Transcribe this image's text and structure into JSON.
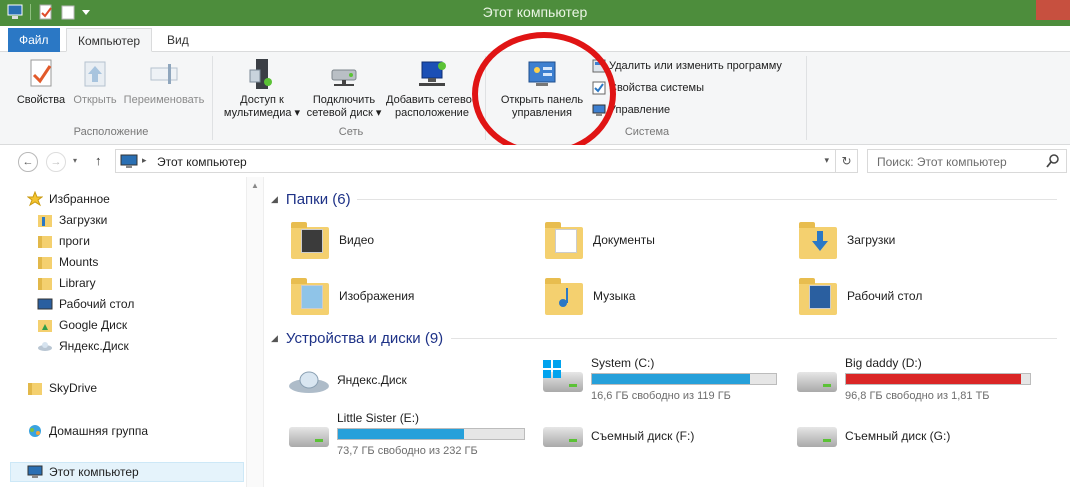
{
  "window": {
    "title": "Этот компьютер"
  },
  "colors": {
    "titlebar": "#4d8d3c",
    "file_tab": "#2b78c5",
    "progress": "#26a0da",
    "progress_full": "#da2626",
    "section_header": "#1e3287",
    "annotation_circle": "#e01414"
  },
  "ribbon": {
    "tabs": [
      "Файл",
      "Компьютер",
      "Вид"
    ],
    "groups": {
      "location": {
        "label": "Расположение",
        "properties": "Свойства",
        "open": "Открыть",
        "rename": "Переименовать"
      },
      "network": {
        "label": "Сеть",
        "media_line1": "Доступ к",
        "media_line2": "мультимедиа",
        "map_drive_line1": "Подключить",
        "map_drive_line2": "сетевой диск",
        "add_location_line1": "Добавить сетевое",
        "add_location_line2": "расположение"
      },
      "system": {
        "label": "Система",
        "control_panel_line1": "Открыть панель",
        "control_panel_line2": "управления",
        "uninstall": "Удалить или изменить программу",
        "system_props": "Свойства системы",
        "manage": "Управление"
      }
    }
  },
  "address": {
    "path": "Этот компьютер",
    "search_placeholder": "Поиск: Этот компьютер"
  },
  "nav": {
    "favorites": "Избранное",
    "items": [
      "Загрузки",
      "проги",
      "Mounts",
      "Library",
      "Рабочий стол",
      "Google Диск",
      "Яндекс.Диск"
    ],
    "skydrive": "SkyDrive",
    "homegroup": "Домашняя группа",
    "this_pc": "Этот компьютер"
  },
  "content": {
    "folders_header": "Папки (6)",
    "folders": [
      "Видео",
      "Документы",
      "Загрузки",
      "Изображения",
      "Музыка",
      "Рабочий стол"
    ],
    "devices_header": "Устройства и диски (9)",
    "devices": [
      {
        "name": "Яндекс.Диск"
      },
      {
        "name": "System (C:)",
        "free": "16,6 ГБ свободно из 119 ГБ",
        "used_fraction": 0.86
      },
      {
        "name": "Big daddy (D:)",
        "free": "96,8 ГБ свободно из 1,81 ТБ",
        "used_fraction": 0.95
      },
      {
        "name": "Little Sister (E:)",
        "free": "73,7 ГБ свободно из 232 ГБ",
        "used_fraction": 0.68
      },
      {
        "name": "Съемный диск (F:)"
      },
      {
        "name": "Съемный диск (G:)"
      }
    ]
  }
}
